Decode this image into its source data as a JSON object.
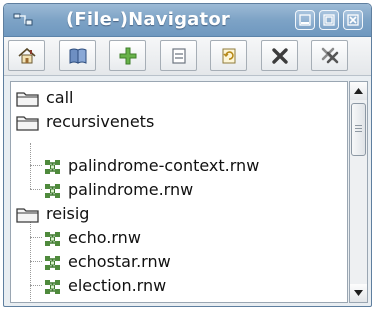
{
  "window": {
    "title": "(File-)Navigator",
    "app_icon": "navigator-app-icon",
    "controls": [
      {
        "name": "minimize-icon"
      },
      {
        "name": "maximize-icon"
      },
      {
        "name": "close-icon"
      }
    ]
  },
  "toolbar": {
    "buttons": [
      {
        "name": "home-icon"
      },
      {
        "name": "open-book-icon"
      },
      {
        "name": "add-icon"
      },
      {
        "name": "document-icon"
      },
      {
        "name": "refresh-icon"
      },
      {
        "name": "delete-icon"
      },
      {
        "name": "delete-all-icon"
      }
    ]
  },
  "tree": {
    "items": [
      {
        "label": "call",
        "type": "folder",
        "depth": 0
      },
      {
        "label": "recursivenets",
        "type": "folder",
        "depth": 0
      },
      {
        "label": "palindrome-context.rnw",
        "type": "net-file",
        "depth": 1
      },
      {
        "label": "palindrome.rnw",
        "type": "net-file",
        "depth": 1
      },
      {
        "label": "reisig",
        "type": "folder",
        "depth": 0
      },
      {
        "label": "echo.rnw",
        "type": "net-file",
        "depth": 1
      },
      {
        "label": "echostar.rnw",
        "type": "net-file",
        "depth": 1
      },
      {
        "label": "election.rnw",
        "type": "net-file",
        "depth": 1
      }
    ]
  },
  "colors": {
    "titlebar": "#7da3c6",
    "folder_outline": "#3a3a3a",
    "net_file_icon": "#4f8a3c",
    "tree_lines": "#9a9a9a"
  }
}
